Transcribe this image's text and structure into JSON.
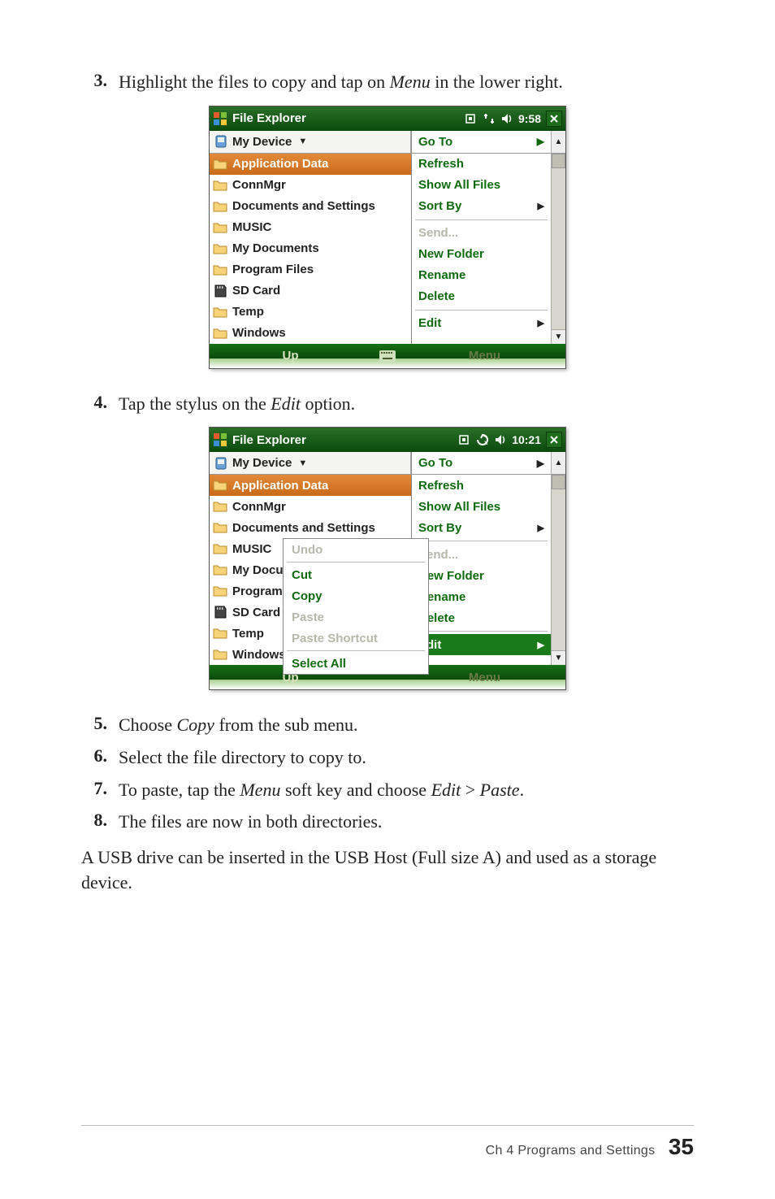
{
  "steps": {
    "s3": {
      "num": "3.",
      "pre": "Highlight the files to copy and tap on ",
      "em": "Menu",
      "post": " in the lower right."
    },
    "s4": {
      "num": "4.",
      "pre": "Tap the stylus on the ",
      "em": "Edit",
      "post": " option."
    },
    "s5": {
      "num": "5.",
      "pre": "Choose ",
      "em": "Copy",
      "post": " from the sub menu."
    },
    "s6": {
      "num": "6.",
      "text": "Select the file directory to copy to."
    },
    "s7": {
      "num": "7.",
      "pre": "To paste, tap the ",
      "em1": "Menu",
      "mid": " soft key and choose ",
      "em2": "Edit",
      "gt": " > ",
      "em3": "Paste",
      "post": "."
    },
    "s8": {
      "num": "8.",
      "text": "The files are now in both directories."
    }
  },
  "paragraph": "A USB drive can be inserted in the USB Host (Full size A) and used as a storage device.",
  "shot1": {
    "title": "File Explorer",
    "clock": "9:58",
    "device_btn": "My Device",
    "files": [
      "Application Data",
      "ConnMgr",
      "Documents and Settings",
      "MUSIC",
      "My Documents",
      "Program Files",
      "SD Card",
      "Temp",
      "Windows"
    ],
    "menu": {
      "goto": "Go To",
      "refresh": "Refresh",
      "showall": "Show All Files",
      "sortby": "Sort By",
      "send": "Send...",
      "newfolder": "New Folder",
      "rename": "Rename",
      "delete": "Delete",
      "edit": "Edit"
    },
    "bottom": {
      "up": "Up",
      "menu": "Menu"
    }
  },
  "shot2": {
    "title": "File Explorer",
    "clock": "10:21",
    "device_btn": "My Device",
    "files": [
      "Application Data",
      "ConnMgr",
      "Documents and Settings",
      "MUSIC",
      "My Document",
      "Program Files",
      "SD Card",
      "Temp",
      "Windows"
    ],
    "menu": {
      "goto": "Go To",
      "refresh": "Refresh",
      "showall": "Show All Files",
      "sortby": "Sort By",
      "send": "Send...",
      "newfolder": "New Folder",
      "rename": "Rename",
      "delete": "Delete",
      "edit": "Edit"
    },
    "editsub": {
      "undo": "Undo",
      "cut": "Cut",
      "copy": "Copy",
      "paste": "Paste",
      "pastesc": "Paste Shortcut",
      "selall": "Select All"
    },
    "bottom": {
      "up": "Up",
      "menu": "Menu"
    }
  },
  "footer": {
    "chapter": "Ch 4    Programs and Settings",
    "page": "35"
  }
}
